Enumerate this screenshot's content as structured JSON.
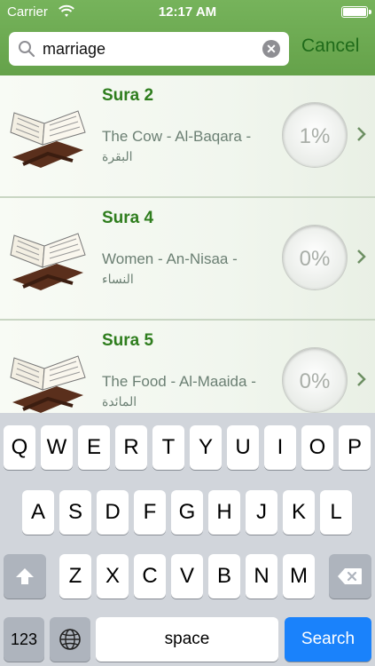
{
  "status_bar": {
    "carrier": "Carrier",
    "time": "12:17 AM"
  },
  "search": {
    "query": "marriage",
    "cancel_label": "Cancel"
  },
  "results": [
    {
      "title": "Sura 2",
      "english": "The Cow",
      "transliteration": "Al-Baqara",
      "arabic": "البقرة",
      "progress": "1%"
    },
    {
      "title": "Sura 4",
      "english": "Women",
      "transliteration": "An-Nisaa",
      "arabic": "النساء",
      "progress": "0%"
    },
    {
      "title": "Sura 5",
      "english": "The Food",
      "transliteration": "Al-Maaida",
      "arabic": "المائدة",
      "progress": "0%"
    }
  ],
  "keyboard": {
    "row1": [
      "Q",
      "W",
      "E",
      "R",
      "T",
      "Y",
      "U",
      "I",
      "O",
      "P"
    ],
    "row2": [
      "A",
      "S",
      "D",
      "F",
      "G",
      "H",
      "J",
      "K",
      "L"
    ],
    "row3": [
      "Z",
      "X",
      "C",
      "V",
      "B",
      "N",
      "M"
    ],
    "numbers_label": "123",
    "space_label": "space",
    "search_label": "Search"
  },
  "colors": {
    "header_green": "#6aa84f",
    "title_green": "#2e7d1d",
    "search_key_blue": "#1a82fb"
  },
  "icons": [
    "wifi-icon",
    "battery-icon",
    "search-icon",
    "clear-icon",
    "quran-book-icon",
    "chevron-right-icon",
    "shift-icon",
    "globe-icon",
    "backspace-icon"
  ]
}
